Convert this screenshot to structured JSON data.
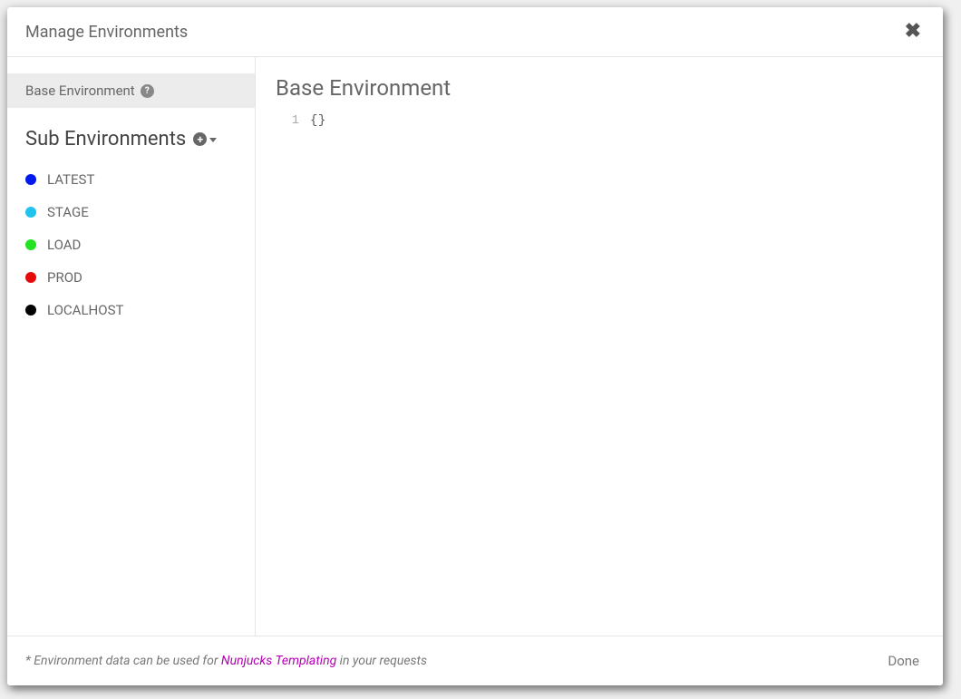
{
  "header": {
    "title": "Manage Environments"
  },
  "sidebar": {
    "baseLabel": "Base Environment",
    "subHeader": "Sub Environments",
    "items": [
      {
        "label": "LATEST",
        "color": "#0019ec"
      },
      {
        "label": "STAGE",
        "color": "#1fc3ee"
      },
      {
        "label": "LOAD",
        "color": "#22e222"
      },
      {
        "label": "PROD",
        "color": "#e50b0b"
      },
      {
        "label": "LOCALHOST",
        "color": "#000000"
      }
    ]
  },
  "main": {
    "title": "Base Environment",
    "editor": {
      "lineNumber": "1",
      "content": "{}"
    }
  },
  "footer": {
    "notePrefix": "* Environment data can be used for ",
    "link": "Nunjucks Templating",
    "noteSuffix": " in your requests",
    "doneLabel": "Done"
  }
}
